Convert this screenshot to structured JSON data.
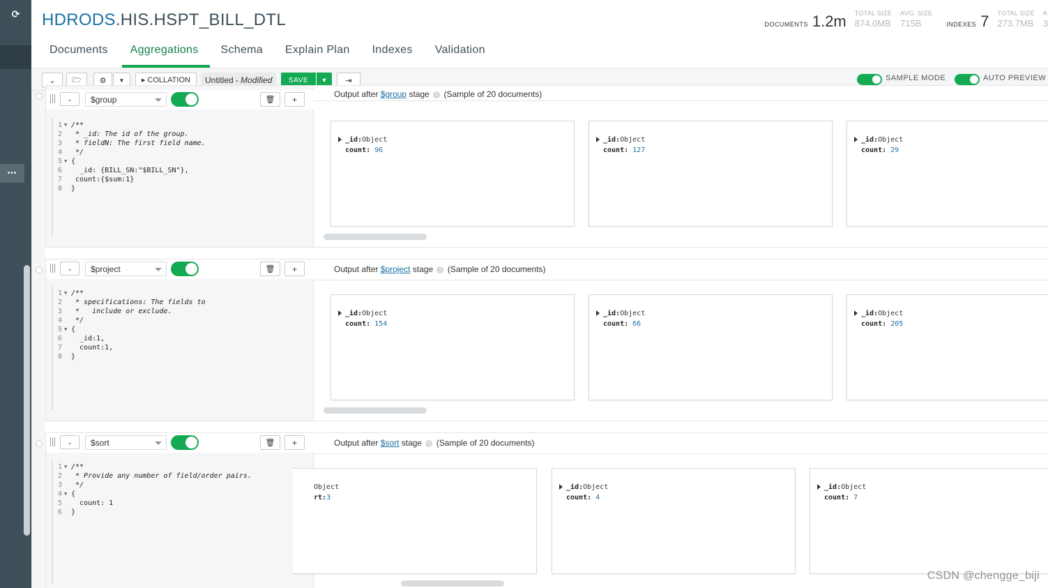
{
  "header": {
    "db": "HDRODS",
    "collection": ".HIS.HSPT_BILL_DTL",
    "documents_label": "DOCUMENTS",
    "documents_value": "1.2m",
    "doc_total_size_label": "TOTAL SIZE",
    "doc_total_size_value": "874.0MB",
    "doc_avg_size_label": "AVG. SIZE",
    "doc_avg_size_value": "715B",
    "indexes_label": "INDEXES",
    "indexes_value": "7",
    "idx_total_size_label": "TOTAL SIZE",
    "idx_total_size_value": "273.7MB",
    "idx_avg_size_label": "A",
    "idx_avg_size_value": "3"
  },
  "tabs": [
    "Documents",
    "Aggregations",
    "Schema",
    "Explain Plan",
    "Indexes",
    "Validation"
  ],
  "active_tab": "Aggregations",
  "toolbar": {
    "collation_label": "COLLATION",
    "pipeline_name": "Untitled",
    "pipeline_status": "- Modified",
    "save_label": "SAVE",
    "sample_mode_label": "SAMPLE MODE",
    "auto_preview_label": "AUTO PREVIEW"
  },
  "stages": [
    {
      "operator": "$group",
      "output_prefix": "Output after",
      "output_suffix": "stage",
      "output_sample": "(Sample of 20 documents)",
      "docs": [
        {
          "key": "_id:",
          "key_value": "Object",
          "field": "count:",
          "value": "96"
        },
        {
          "key": "_id:",
          "key_value": "Object",
          "field": "count:",
          "value": "127"
        },
        {
          "key": "_id:",
          "key_value": "Object",
          "field": "count:",
          "value": "29"
        }
      ]
    },
    {
      "operator": "$project",
      "output_prefix": "Output after",
      "output_suffix": "stage",
      "output_sample": "(Sample of 20 documents)",
      "docs": [
        {
          "key": "_id:",
          "key_value": "Object",
          "field": "count:",
          "value": "154"
        },
        {
          "key": "_id:",
          "key_value": "Object",
          "field": "count:",
          "value": "66"
        },
        {
          "key": "_id:",
          "key_value": "Object",
          "field": "count:",
          "value": "205"
        }
      ]
    },
    {
      "operator": "$sort",
      "output_prefix": "Output after",
      "output_suffix": "stage",
      "output_sample": "(Sample of 20 documents)",
      "docs": [
        {
          "key": "",
          "key_value": "Object",
          "field": "rt:",
          "value": "3"
        },
        {
          "key": "_id:",
          "key_value": "Object",
          "field": "count:",
          "value": "4"
        },
        {
          "key": "_id:",
          "key_value": "Object",
          "field": "count:",
          "value": "7"
        }
      ]
    }
  ],
  "code": {
    "group": [
      "/**",
      " * _id: The id of the group.",
      " * fieldN: The first field name.",
      " */",
      "{",
      "  _id: {BILL_SN:\"$BILL_SN\"},",
      " count:{$sum:1}",
      "}"
    ],
    "project": [
      "/**",
      " * specifications: The fields to",
      " *   include or exclude.",
      " */",
      "{",
      "  _id:1,",
      "  count:1,",
      "}"
    ],
    "sort": [
      "/**",
      " * Provide any number of field/order pairs.",
      " */",
      "{",
      "  count: 1",
      "}"
    ]
  },
  "watermark": "CSDN @chengge_biji",
  "colors": {
    "accent": "#13aa52",
    "nav": "#3d4f58",
    "link": "#1a6fa4"
  }
}
